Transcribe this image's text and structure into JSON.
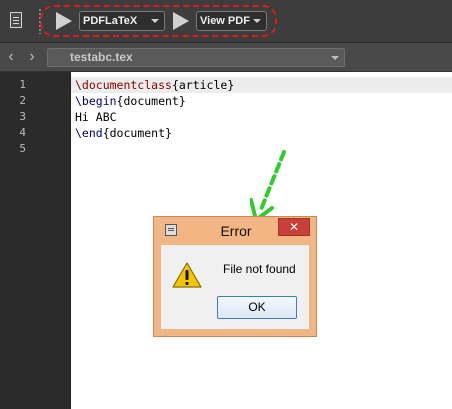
{
  "toolbar": {
    "compiler": {
      "selected": "PDFLaTeX"
    },
    "viewer": {
      "selected": "View PDF"
    }
  },
  "tabbar": {
    "back_glyph": "‹",
    "forward_glyph": "›",
    "open_file": "testabc.tex"
  },
  "editor": {
    "line_numbers": [
      "1",
      "2",
      "3",
      "4",
      "5"
    ],
    "lines": [
      {
        "cmd": "\\documentclass",
        "arg": "{article}",
        "text": ""
      },
      {
        "cmd": "\\begin",
        "arg": "{document}",
        "text": ""
      },
      {
        "cmd": "",
        "arg": "",
        "text": "Hi ABC"
      },
      {
        "cmd": "\\end",
        "arg": "{document}",
        "text": ""
      },
      {
        "cmd": "",
        "arg": "",
        "text": ""
      }
    ]
  },
  "dialog": {
    "title": "Error",
    "close_glyph": "✕",
    "message": "File not found",
    "ok_label": "OK"
  },
  "colors": {
    "annotation_red": "#d81e1e",
    "annotation_green": "#2ecc2e",
    "dialog_frame": "#f2b584",
    "close_button": "#c7413a"
  },
  "icons": [
    "document-icon",
    "run-arrow-icon",
    "chevron-down-icon",
    "warning-icon",
    "close-icon",
    "window-icon"
  ]
}
